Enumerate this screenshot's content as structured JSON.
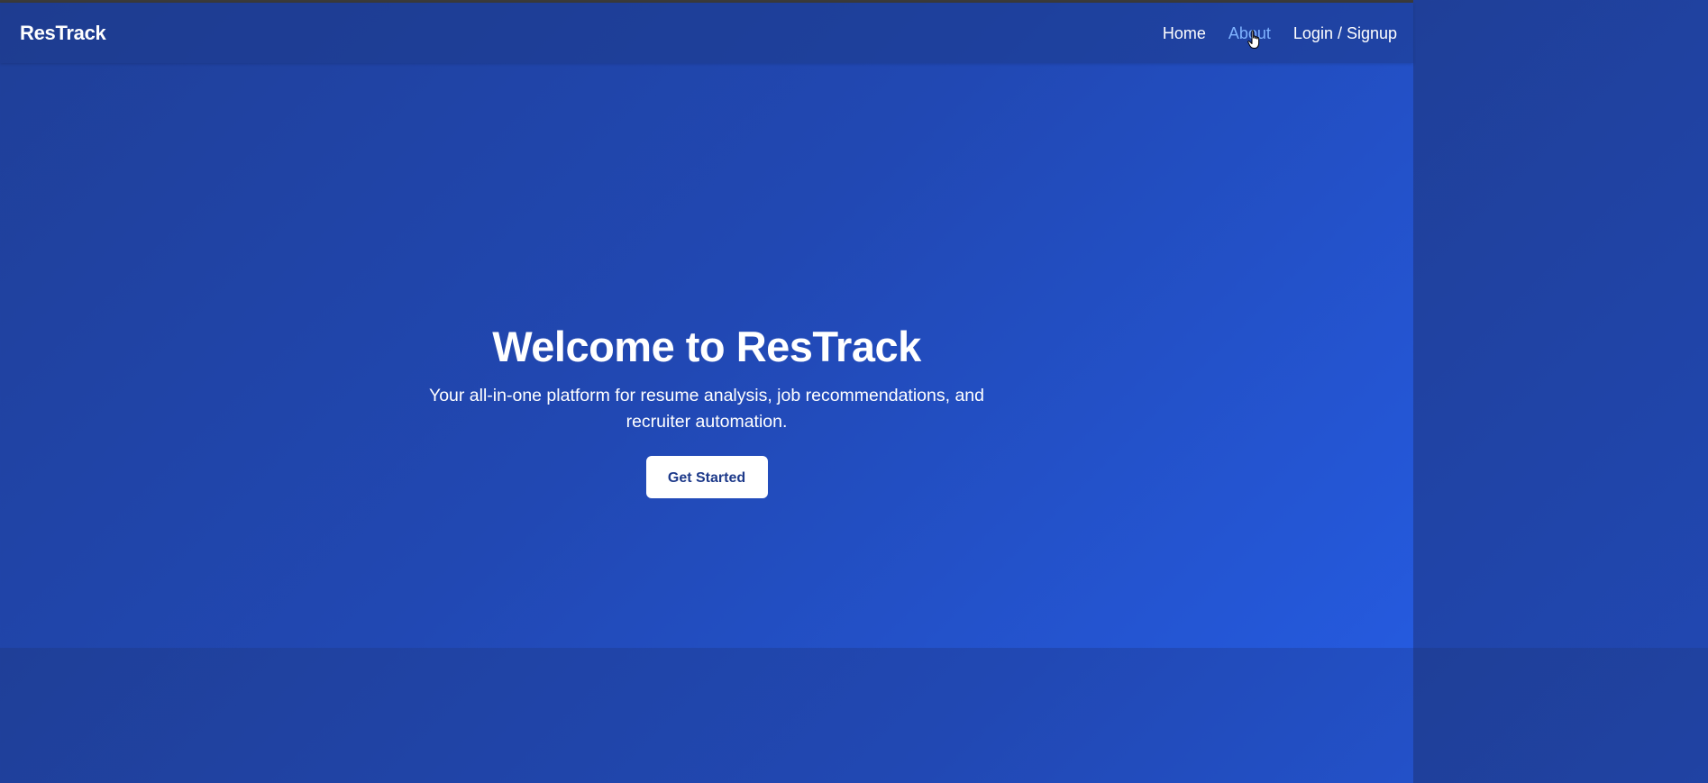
{
  "nav": {
    "brand": "ResTrack",
    "links": [
      {
        "label": "Home"
      },
      {
        "label": "About"
      },
      {
        "label": "Login / Signup"
      }
    ],
    "active_link": "About"
  },
  "hero": {
    "title": "Welcome to ResTrack",
    "subtitle": "Your all-in-one platform for resume analysis, job recommendations, and recruiter automation.",
    "cta_label": "Get Started"
  },
  "colors": {
    "background_start": "#1f3f98",
    "background_end": "#255ade",
    "text": "#ffffff",
    "active_link": "#7fb3ff",
    "button_text": "#1e3a8a"
  },
  "icons": {
    "pointer": "hand-pointer-icon"
  }
}
